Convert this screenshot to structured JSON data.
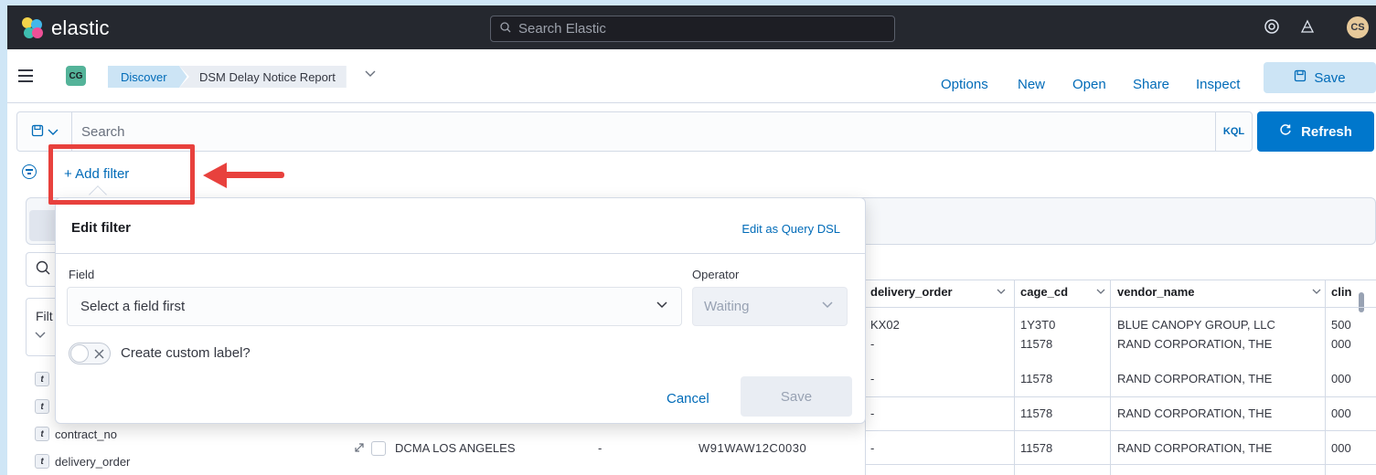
{
  "header": {
    "brand": "elastic",
    "search_placeholder": "Search Elastic",
    "icons": [
      "help-icon",
      "newsfeed-icon"
    ],
    "user_initials": "CS"
  },
  "nav": {
    "space_initials": "CG",
    "breadcrumbs": [
      "Discover",
      "DSM Delay Notice Report"
    ],
    "menu": [
      "Options",
      "New",
      "Open",
      "Share",
      "Inspect"
    ],
    "save_label": "Save"
  },
  "query": {
    "placeholder": "Search",
    "language": "KQL",
    "refresh_label": "Refresh"
  },
  "filter": {
    "add_label": "+ Add filter"
  },
  "sidebar": {
    "filter_label": "Filt",
    "fields": [
      "contract_no",
      "delivery_order"
    ]
  },
  "table": {
    "columns": [
      "delivery_order",
      "cage_cd",
      "vendor_name",
      "clin"
    ],
    "rows": [
      {
        "delivery_order": "KX02",
        "cage_cd": "1Y3T0",
        "vendor_name": "BLUE CANOPY GROUP, LLC",
        "clin": "500"
      },
      {
        "delivery_order": "-",
        "cage_cd": "11578",
        "vendor_name": "RAND CORPORATION, THE",
        "clin": "000"
      },
      {
        "delivery_order": "-",
        "cage_cd": "11578",
        "vendor_name": "RAND CORPORATION, THE",
        "clin": "000"
      },
      {
        "delivery_order": "-",
        "cage_cd": "11578",
        "vendor_name": "RAND CORPORATION, THE",
        "clin": "000"
      },
      {
        "delivery_order": "-",
        "cage_cd": "11578",
        "vendor_name": "RAND CORPORATION, THE",
        "clin": "000"
      }
    ],
    "partial_row": {
      "office": "DCMA LOS ANGELES",
      "dash": "-",
      "contract": "W91WAW12C0030"
    }
  },
  "popover": {
    "title": "Edit filter",
    "edit_dsl": "Edit as Query DSL",
    "field_label": "Field",
    "field_placeholder": "Select a field first",
    "operator_label": "Operator",
    "operator_placeholder": "Waiting",
    "custom_label": "Create custom label?",
    "cancel": "Cancel",
    "save": "Save"
  },
  "colors": {
    "accent": "#006bb8",
    "annotation": "#e8413d",
    "header_bg": "#25282f"
  }
}
